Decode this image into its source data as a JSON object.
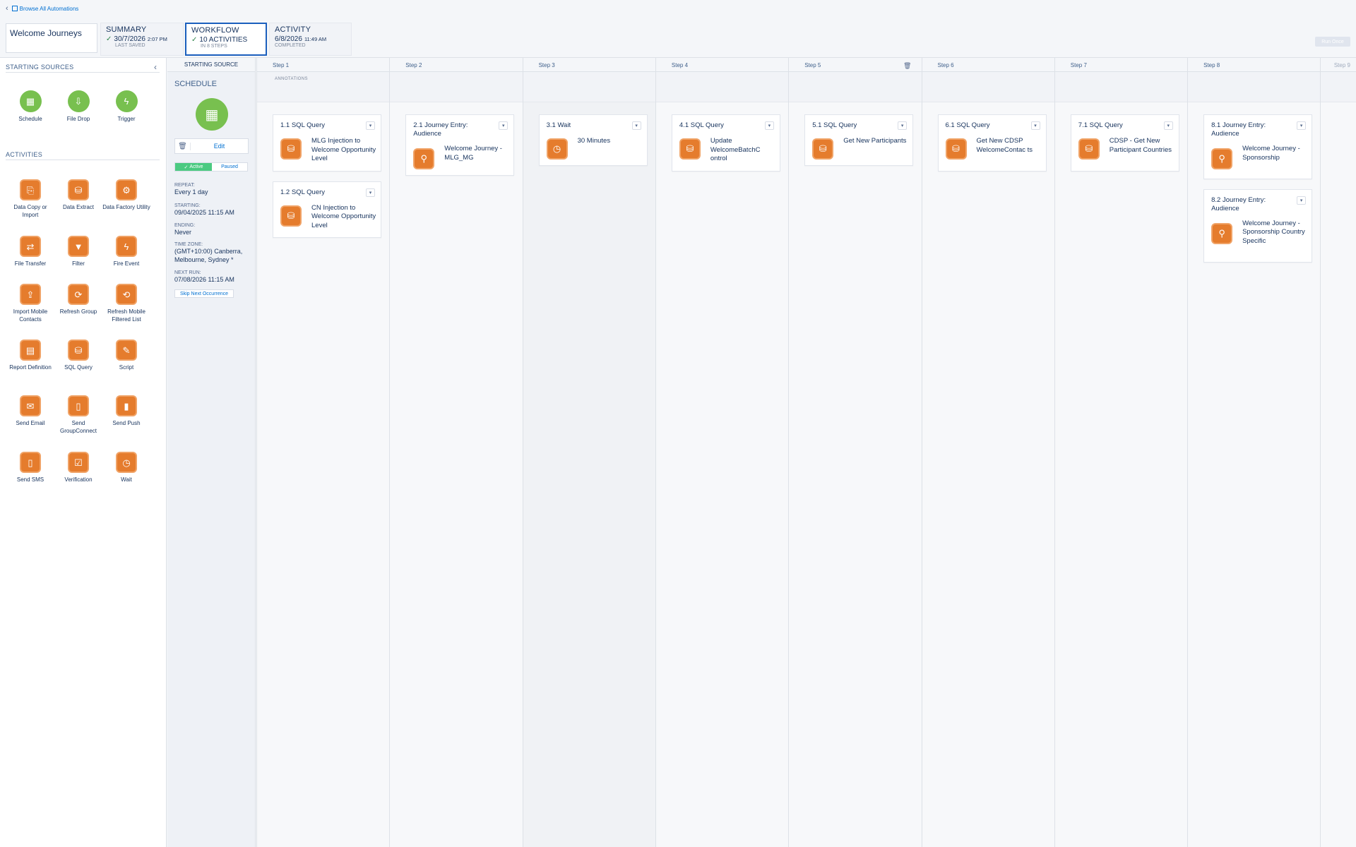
{
  "header": {
    "back_link": "Browse All Automations",
    "automation_name": "Welcome Journeys",
    "run_once": "Run Once",
    "tabs": [
      {
        "title": "SUMMARY",
        "line": "30/7/2026",
        "line_small": "2:07 PM",
        "sub": "LAST SAVED"
      },
      {
        "title": "WORKFLOW",
        "line": "10 ACTIVITIES",
        "line_small": "",
        "sub": "IN 8 STEPS"
      },
      {
        "title": "ACTIVITY",
        "line": "6/8/2026",
        "line_small": "11:49 AM",
        "sub": "COMPLETED"
      }
    ]
  },
  "left_panel": {
    "starting_sources_title": "STARTING SOURCES",
    "activities_title": "ACTIVITIES",
    "starting_sources": [
      {
        "label": "Schedule",
        "icon": "calendar-icon"
      },
      {
        "label": "File Drop",
        "icon": "file-drop-icon"
      },
      {
        "label": "Trigger",
        "icon": "lightning-icon"
      }
    ],
    "activities": [
      {
        "label": "Data Copy or Import",
        "icon": "data-copy-icon"
      },
      {
        "label": "Data Extract",
        "icon": "data-extract-icon"
      },
      {
        "label": "Data Factory Utility",
        "icon": "data-factory-icon"
      },
      {
        "label": "File Transfer",
        "icon": "file-transfer-icon"
      },
      {
        "label": "Filter",
        "icon": "filter-icon"
      },
      {
        "label": "Fire Event",
        "icon": "lightning-icon"
      },
      {
        "label": "Import Mobile Contacts",
        "icon": "import-contacts-icon"
      },
      {
        "label": "Refresh Group",
        "icon": "refresh-group-icon"
      },
      {
        "label": "Refresh Mobile Filtered List",
        "icon": "refresh-list-icon"
      },
      {
        "label": "Report Definition",
        "icon": "report-icon"
      },
      {
        "label": "SQL Query",
        "icon": "sql-query-icon"
      },
      {
        "label": "Script",
        "icon": "script-icon"
      },
      {
        "label": "Send Email",
        "icon": "email-icon"
      },
      {
        "label": "Send GroupConnect",
        "icon": "groupconnect-icon"
      },
      {
        "label": "Send Push",
        "icon": "push-icon"
      },
      {
        "label": "Send SMS",
        "icon": "sms-icon"
      },
      {
        "label": "Verification",
        "icon": "verification-icon"
      },
      {
        "label": "Wait",
        "icon": "clock-icon"
      }
    ]
  },
  "schedule": {
    "column_header": "STARTING SOURCE",
    "title": "SCHEDULE",
    "edit": "Edit",
    "active": "Active",
    "paused": "Paused",
    "fields": [
      {
        "label": "REPEAT:",
        "value": "Every 1 day"
      },
      {
        "label": "STARTING:",
        "value": "09/04/2025 11:15 AM"
      },
      {
        "label": "ENDING:",
        "value": "Never"
      },
      {
        "label": "TIME ZONE:",
        "value": "(GMT+10:00) Canberra, Melbourne, Sydney *"
      },
      {
        "label": "NEXT RUN:",
        "value": "07/08/2026 11:15 AM"
      }
    ],
    "skip_next": "Skip Next Occurrence"
  },
  "annotations_label": "ANNOTATIONS",
  "steps": [
    {
      "label": "Step 1",
      "cards": [
        {
          "title": "1.1 SQL Query",
          "text": "MLG Injection to Welcome Opportunity Level",
          "icon": "sql-query-icon"
        },
        {
          "title": "1.2 SQL Query",
          "text": "CN Injection to Welcome Opportunity Level",
          "icon": "sql-query-icon"
        }
      ]
    },
    {
      "label": "Step 2",
      "cards": [
        {
          "title": "2.1 Journey Entry: Audience",
          "text": "Welcome Journey - MLG_MG",
          "icon": "location-pin-icon"
        }
      ]
    },
    {
      "label": "Step 3",
      "cards": [
        {
          "title": "3.1 Wait",
          "text": "30 Minutes",
          "icon": "clock-icon"
        }
      ]
    },
    {
      "label": "Step 4",
      "cards": [
        {
          "title": "4.1 SQL Query",
          "text": "Update WelcomeBatchC ontrol",
          "icon": "sql-query-icon"
        }
      ]
    },
    {
      "label": "Step 5",
      "cards": [
        {
          "title": "5.1 SQL Query",
          "text": "Get New Participants",
          "icon": "sql-query-icon"
        }
      ]
    },
    {
      "label": "Step 6",
      "cards": [
        {
          "title": "6.1 SQL Query",
          "text": "Get New CDSP WelcomeContac ts",
          "icon": "sql-query-icon"
        }
      ]
    },
    {
      "label": "Step 7",
      "cards": [
        {
          "title": "7.1 SQL Query",
          "text": "CDSP - Get New Participant Countries",
          "icon": "sql-query-icon"
        }
      ]
    },
    {
      "label": "Step 8",
      "cards": [
        {
          "title": "8.1 Journey Entry: Audience",
          "text": "Welcome Journey - Sponsorship",
          "icon": "location-pin-icon"
        },
        {
          "title": "8.2 Journey Entry: Audience",
          "text": "Welcome Journey - Sponsorship Country Specific",
          "icon": "location-pin-icon"
        }
      ]
    },
    {
      "label": "Step 9",
      "cards": []
    }
  ]
}
